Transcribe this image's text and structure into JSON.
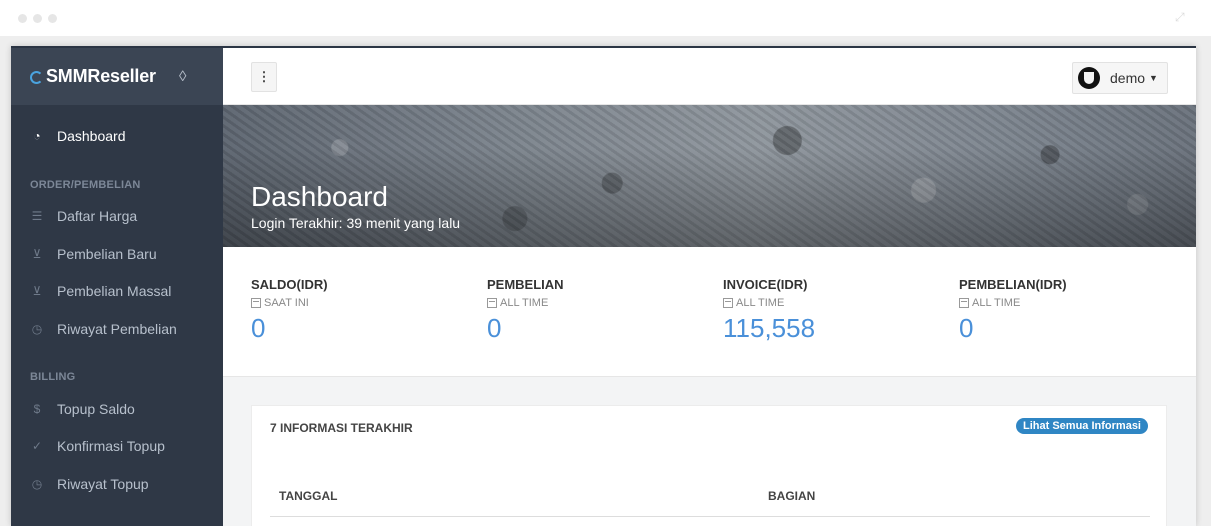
{
  "app": {
    "brand": "SMMReseller"
  },
  "sidebar": {
    "dashboard": "Dashboard",
    "sections": [
      {
        "heading": "ORDER/PEMBELIAN",
        "items": [
          "Daftar Harga",
          "Pembelian Baru",
          "Pembelian Massal",
          "Riwayat Pembelian"
        ]
      },
      {
        "heading": "BILLING",
        "items": [
          "Topup Saldo",
          "Konfirmasi Topup",
          "Riwayat Topup"
        ]
      }
    ]
  },
  "topbar": {
    "menu_icon": "⋮",
    "user": "demo"
  },
  "hero": {
    "title": "Dashboard",
    "subtitle": "Login Terakhir: 39 menit yang lalu"
  },
  "stats": [
    {
      "title": "SALDO(IDR)",
      "period": "SAAT INI",
      "value": "0"
    },
    {
      "title": "PEMBELIAN",
      "period": "ALL TIME",
      "value": "0"
    },
    {
      "title": "INVOICE(IDR)",
      "period": "ALL TIME",
      "value": "115,558"
    },
    {
      "title": "PEMBELIAN(IDR)",
      "period": "ALL TIME",
      "value": "0"
    }
  ],
  "info_panel": {
    "title": "7 INFORMASI TERAKHIR",
    "button": "Lihat Semua Informasi",
    "columns": [
      "TANGGAL",
      "BAGIAN"
    ]
  }
}
